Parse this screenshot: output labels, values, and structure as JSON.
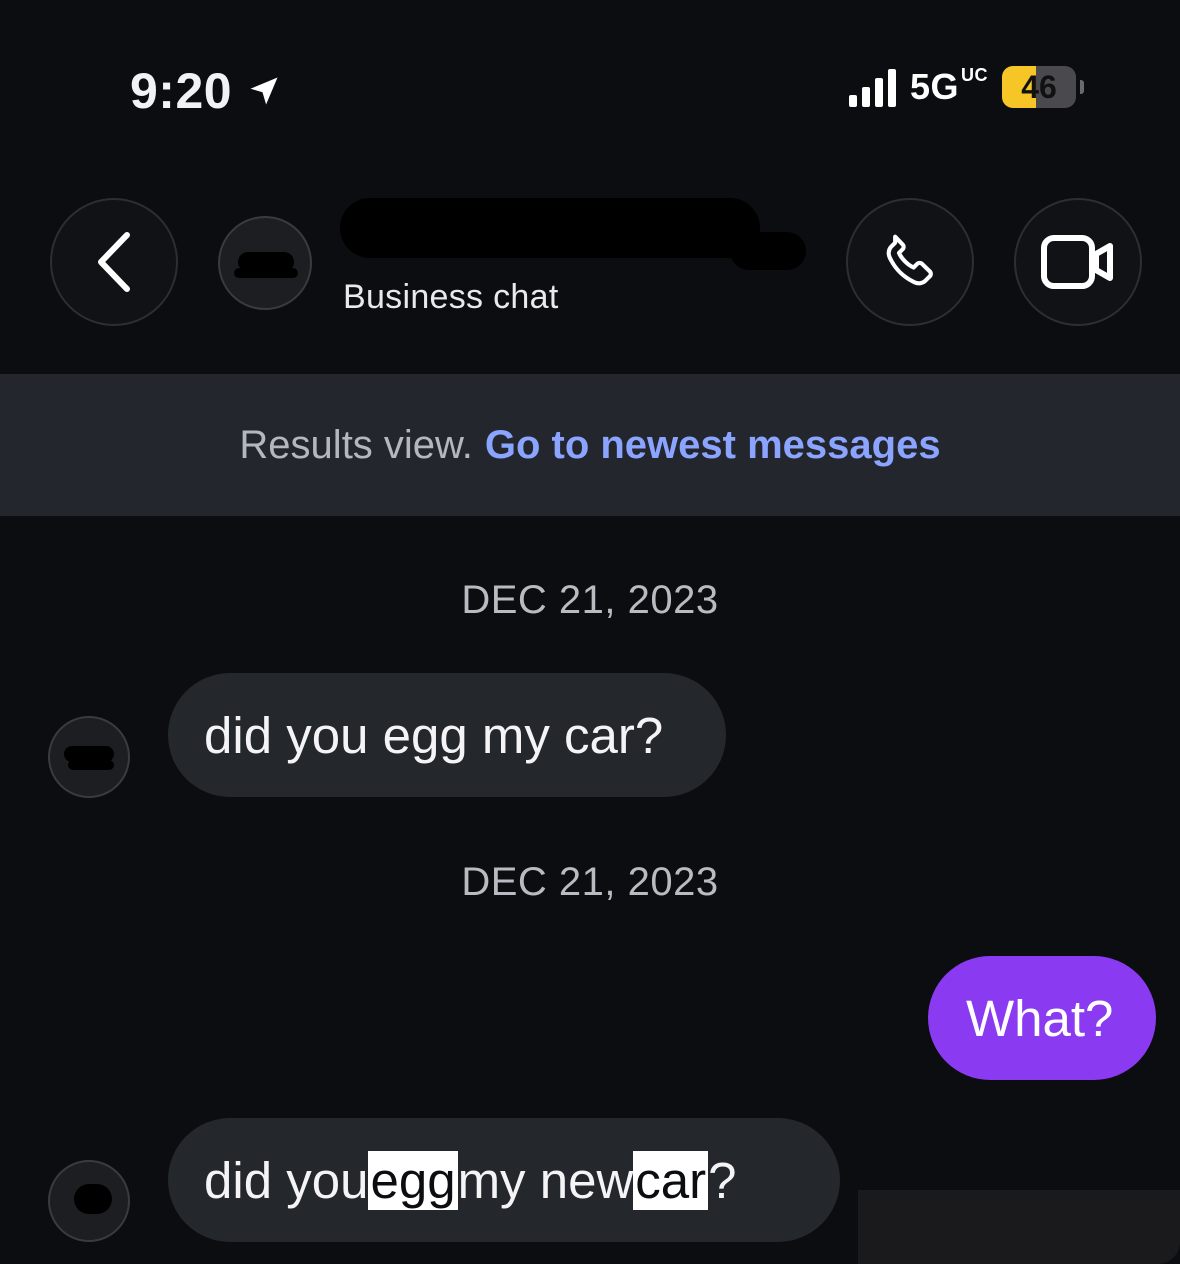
{
  "status_bar": {
    "time": "9:20",
    "network": "5G",
    "network_suffix": "UC",
    "battery": "46",
    "battery_level": 0.46
  },
  "header": {
    "contact_subtitle": "Business chat"
  },
  "banner": {
    "text": "Results view.",
    "link": "Go to newest messages"
  },
  "messages": [
    {
      "date": "DEC 21, 2023",
      "direction": "incoming",
      "text": "did you egg my car?"
    },
    {
      "date": "DEC 21, 2023",
      "direction": "outgoing",
      "text": "What?"
    },
    {
      "direction": "incoming",
      "parts": [
        "did you ",
        "egg",
        " my new ",
        "car",
        "?"
      ],
      "highlighted_terms": [
        "egg",
        "car"
      ]
    }
  ],
  "colors": {
    "background": "#0c0d10",
    "incoming_bubble": "#24272c",
    "outgoing_bubble": "#8a3af0",
    "link": "#8aa4ff",
    "battery": "#f5c626"
  },
  "icons": [
    "location-arrow-icon",
    "signal-icon",
    "battery-icon",
    "chevron-left-icon",
    "phone-icon",
    "video-camera-icon"
  ]
}
